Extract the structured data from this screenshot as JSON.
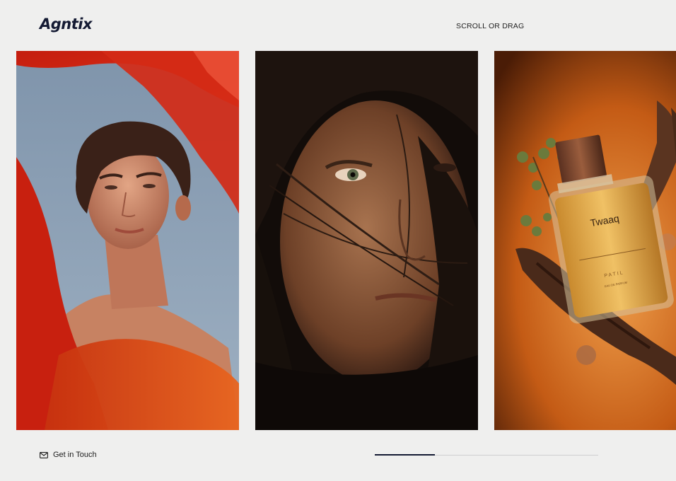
{
  "header": {
    "logo": "Agntix",
    "scroll_hint": "SCROLL OR DRAG"
  },
  "gallery": {
    "cards": [
      {
        "name": "man-red-fabric",
        "alt": "Young man with red fabric against blue sky"
      },
      {
        "name": "woman-hair-portrait",
        "alt": "Woman portrait with hair over face"
      },
      {
        "name": "perfume-bottle",
        "alt": "Perfume bottle with wood",
        "bottle_brand": "Twaaq",
        "bottle_subtext": "PATIL",
        "bottle_small": "EAU DE PARFUM"
      }
    ]
  },
  "footer": {
    "contact_label": "Get in Touch",
    "contact_icon": "mail-icon",
    "progress": 0.27
  },
  "colors": {
    "brand": "#141a33",
    "background": "#efefee"
  }
}
